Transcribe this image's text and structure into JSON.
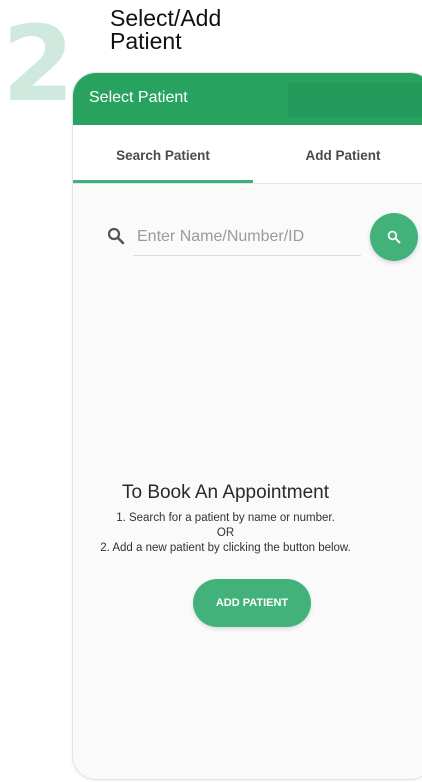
{
  "step": {
    "number": "2",
    "title_line1": "Select/Add",
    "title_line2": "Patient"
  },
  "appbar": {
    "title": "Select Patient"
  },
  "tabs": [
    {
      "label": "Search Patient",
      "active": true
    },
    {
      "label": "Add Patient",
      "active": false
    }
  ],
  "search": {
    "placeholder": "Enter Name/Number/ID",
    "value": ""
  },
  "empty_state": {
    "title": "To Book An Appointment",
    "line1": "1. Search for a patient by name or number.",
    "or": "OR",
    "line2": "2. Add a new patient by clicking the button below."
  },
  "add_button": {
    "label": "ADD PATIENT"
  },
  "colors": {
    "primary": "#27a25f",
    "accent": "#43b27a",
    "step_number": "#cfe9df"
  },
  "icons": {
    "search": "search-icon",
    "search_fab": "search-icon"
  }
}
